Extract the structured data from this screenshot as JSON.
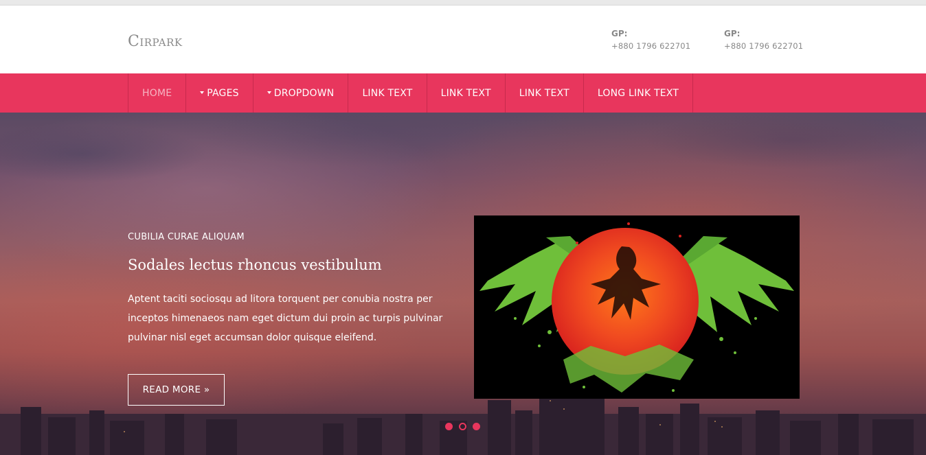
{
  "header": {
    "logo": "Cirpark",
    "contacts": [
      {
        "label": "GP:",
        "number": "+880 1796 622701"
      },
      {
        "label": "GP:",
        "number": "+880 1796 622701"
      }
    ]
  },
  "nav": {
    "items": [
      {
        "label": "HOME",
        "active": true,
        "dropdown": false
      },
      {
        "label": "PAGES",
        "active": false,
        "dropdown": true
      },
      {
        "label": "DROPDOWN",
        "active": false,
        "dropdown": true
      },
      {
        "label": "LINK TEXT",
        "active": false,
        "dropdown": false
      },
      {
        "label": "LINK TEXT",
        "active": false,
        "dropdown": false
      },
      {
        "label": "LINK TEXT",
        "active": false,
        "dropdown": false
      },
      {
        "label": "LONG LINK TEXT",
        "active": false,
        "dropdown": false
      }
    ]
  },
  "hero": {
    "kicker": "CUBILIA CURAE ALIQUAM",
    "title": "Sodales lectus rhoncus vestibulum",
    "description": "Aptent taciti sociosqu ad litora torquent per conubia nostra per inceptos himenaeos nam eget dictum dui proin ac turpis pulvinar pulvinar nisl eget accumsan dolor quisque eleifend.",
    "button": "READ MORE »",
    "slides": {
      "total": 3,
      "current": 2
    }
  },
  "colors": {
    "accent": "#e8365d",
    "flag_red": "#e63425",
    "flag_green": "#6fbf3a"
  }
}
